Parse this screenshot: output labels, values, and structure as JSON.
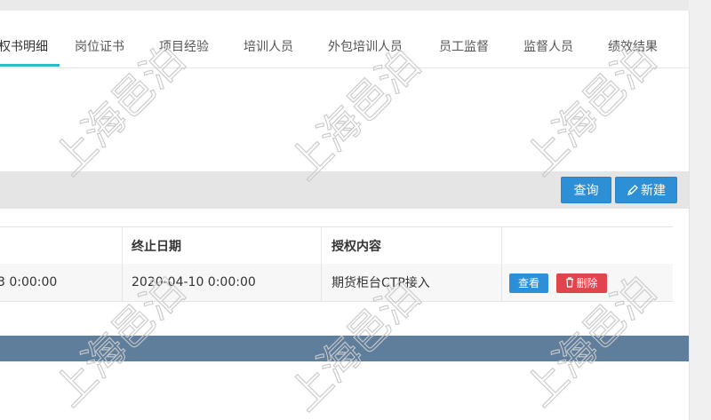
{
  "tabs": [
    {
      "label": "权书明细",
      "active": true
    },
    {
      "label": "岗位证书"
    },
    {
      "label": "项目经验"
    },
    {
      "label": "培训人员"
    },
    {
      "label": "外包培训人员"
    },
    {
      "label": "员工监督"
    },
    {
      "label": "监督人员"
    },
    {
      "label": "绩效结果"
    }
  ],
  "toolbar": {
    "query_label": "查询",
    "new_label": "新建"
  },
  "table": {
    "headers": [
      "终止日期",
      "授权内容"
    ],
    "rows": [
      {
        "start_fragment": "3 0:00:00",
        "end_date": "2020-04-10 0:00:00",
        "content": "期货柜台CTP接入",
        "view_label": "查看",
        "delete_label": "删除"
      }
    ]
  },
  "watermark": {
    "text": "上海邑泊"
  },
  "colors": {
    "accent": "#2d8fd6",
    "tab_underline": "#2fb7d1",
    "danger": "#e0454e",
    "footer": "#5f7e9c"
  }
}
